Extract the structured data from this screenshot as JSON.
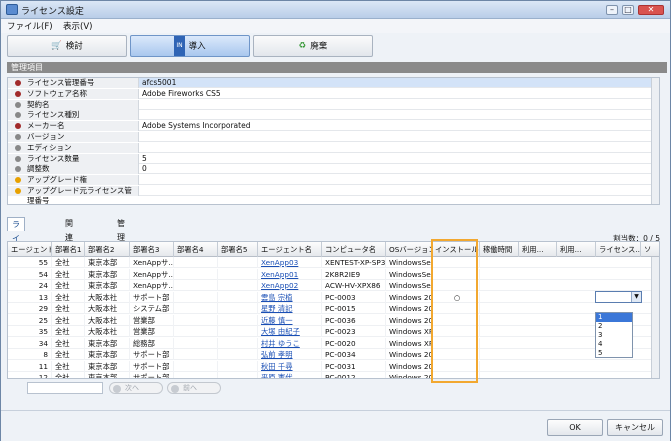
{
  "window": {
    "title": "ライセンス設定"
  },
  "menu": {
    "file": "ファイル(F)",
    "view": "表示(V)"
  },
  "toolbar": {
    "review": "検討",
    "introduce": "導入",
    "dispose": "廃棄"
  },
  "section": {
    "title": "管理項目"
  },
  "props": [
    {
      "label": "ライセンス管理番号",
      "value": "afcs5001",
      "dot": "#a12a2a"
    },
    {
      "label": "ソフトウェア名称",
      "value": "Adobe Fireworks CS5",
      "dot": "#a12a2a"
    },
    {
      "label": "契約名",
      "value": "",
      "dot": "#888888"
    },
    {
      "label": "ライセンス種別",
      "value": "",
      "dot": "#888888"
    },
    {
      "label": "メーカー名",
      "value": "Adobe Systems Incorporated",
      "dot": "#a12a2a"
    },
    {
      "label": "バージョン",
      "value": "",
      "dot": "#888888"
    },
    {
      "label": "エディション",
      "value": "",
      "dot": "#888888"
    },
    {
      "label": "ライセンス数量",
      "value": "5",
      "dot": "#888888"
    },
    {
      "label": "調整数",
      "value": "0",
      "dot": "#888888"
    },
    {
      "label": "アップグレード権",
      "value": "",
      "dot": "#e8a100"
    },
    {
      "label": "アップグレード元ライセンス管理番号",
      "value": "",
      "dot": "#e8a100"
    }
  ],
  "tabs": {
    "t1": "ライセンス割当",
    "t2": "関連ソフトウェア",
    "t3": "管理部署"
  },
  "grid": {
    "count": "割当数：0 / 5",
    "headers": [
      "エージェントNO",
      "部署名1",
      "部署名2",
      "部署名3",
      "部署名4",
      "部署名5",
      "エージェント名",
      "コンピュータ名",
      "OSバージョン",
      "インストール",
      "稼働時間",
      "利用...",
      "利用...",
      "ライセンス...",
      "ソ"
    ],
    "rows": [
      {
        "no": "55",
        "d1": "全社",
        "d2": "東京本部",
        "d3": "XenAppサ...",
        "agent": "XenApp03",
        "pc": "XENTEST-XP-SP3",
        "os": "WindowsSer...",
        "inst": ""
      },
      {
        "no": "54",
        "d1": "全社",
        "d2": "東京本部",
        "d3": "XenAppサ...",
        "agent": "XenApp01",
        "pc": "2K8R2IE9",
        "os": "WindowsSer...",
        "inst": ""
      },
      {
        "no": "24",
        "d1": "全社",
        "d2": "東京本部",
        "d3": "XenAppサ...",
        "agent": "XenApp02",
        "pc": "ACW-HV-XPX86",
        "os": "WindowsSer...",
        "inst": ""
      },
      {
        "no": "13",
        "d1": "全社",
        "d2": "大阪本社",
        "d3": "サポート部",
        "agent": "雲島 宗植",
        "pc": "PC-0003",
        "os": "Windows 20...",
        "inst": "○"
      },
      {
        "no": "29",
        "d1": "全社",
        "d2": "大阪本社",
        "d3": "システム部",
        "agent": "星野 清記",
        "pc": "PC-0015",
        "os": "Windows 20...",
        "inst": ""
      },
      {
        "no": "25",
        "d1": "全社",
        "d2": "大阪本社",
        "d3": "営業部",
        "agent": "近藤 慎一",
        "pc": "PC-0036",
        "os": "Windows 20...",
        "inst": ""
      },
      {
        "no": "35",
        "d1": "全社",
        "d2": "大阪本社",
        "d3": "営業部",
        "agent": "大塚 由紀子",
        "pc": "PC-0023",
        "os": "Windows XP ...",
        "inst": ""
      },
      {
        "no": "34",
        "d1": "全社",
        "d2": "東京本部",
        "d3": "総務部",
        "agent": "村井 ゆうこ",
        "pc": "PC-0020",
        "os": "Windows XP ...",
        "inst": ""
      },
      {
        "no": "8",
        "d1": "全社",
        "d2": "東京本部",
        "d3": "サポート部",
        "agent": "弘前 孝明",
        "pc": "PC-0034",
        "os": "Windows 20...",
        "inst": ""
      },
      {
        "no": "11",
        "d1": "全社",
        "d2": "東京本部",
        "d3": "サポート部",
        "agent": "秋田 千尋",
        "pc": "PC-0031",
        "os": "Windows 20...",
        "inst": ""
      },
      {
        "no": "12",
        "d1": "全社",
        "d2": "東京本部",
        "d3": "サポート部",
        "agent": "平原 憲代",
        "pc": "PC-0012",
        "os": "Windows 20...",
        "inst": ""
      }
    ]
  },
  "dropdown": {
    "options": [
      "1",
      "2",
      "3",
      "4",
      "5"
    ]
  },
  "nav": {
    "prev": "次へ",
    "next": "前へ"
  },
  "footer": {
    "ok": "OK",
    "cancel": "キャンセル"
  }
}
